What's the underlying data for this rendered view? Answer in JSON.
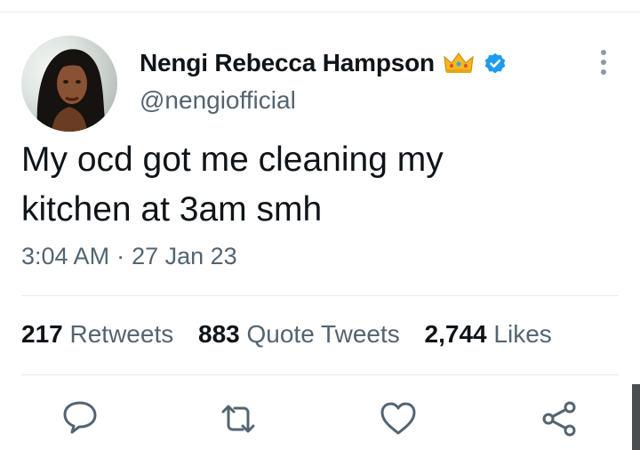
{
  "tweet": {
    "author_name": "Nengi Rebecca Hampson",
    "handle": "@nengiofficial",
    "text_line1": "My ocd got me cleaning my",
    "text_line2": "kitchen at 3am smh",
    "time": "3:04 AM",
    "date": "27 Jan 23",
    "separator": "·"
  },
  "stats": {
    "retweets_count": "217",
    "retweets_label": "Retweets",
    "quotes_count": "883",
    "quotes_label": "Quote Tweets",
    "likes_count": "2,744",
    "likes_label": "Likes"
  },
  "icons": {
    "crown": "crown-emoji-icon",
    "verified": "verified-badge-icon",
    "more": "more-options-icon",
    "reply": "reply-icon",
    "retweet": "retweet-icon",
    "like": "like-icon",
    "share": "share-icon"
  },
  "colors": {
    "primary_text": "#0f1419",
    "secondary_text": "#536471",
    "verified_blue": "#1d9bf0",
    "icon_gray": "#536471"
  }
}
